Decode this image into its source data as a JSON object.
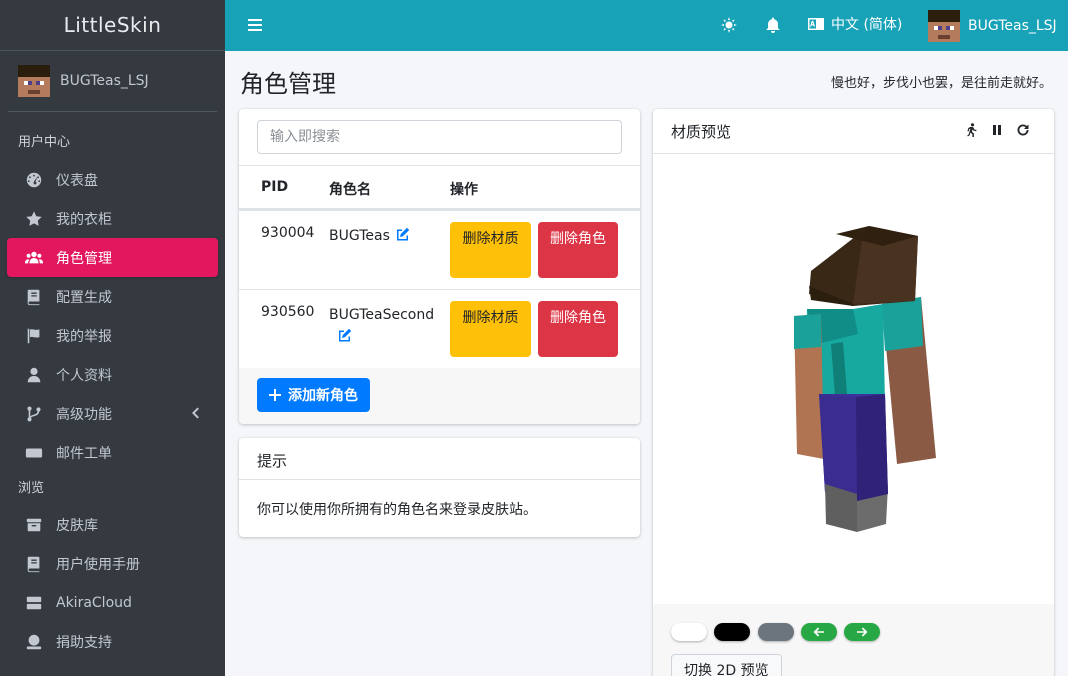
{
  "brand": {
    "name": "LittleSkin"
  },
  "user": {
    "name": "BUGTeas_LSJ"
  },
  "sidebar": {
    "section_user": "用户中心",
    "section_browse": "浏览",
    "items": [
      {
        "label": "仪表盘",
        "icon": "dashboard-icon"
      },
      {
        "label": "我的衣柜",
        "icon": "star-icon"
      },
      {
        "label": "角色管理",
        "icon": "users-icon",
        "active": true
      },
      {
        "label": "配置生成",
        "icon": "book-icon"
      },
      {
        "label": "我的举报",
        "icon": "flag-icon"
      },
      {
        "label": "个人资料",
        "icon": "user-icon"
      },
      {
        "label": "高级功能",
        "icon": "branch-icon"
      },
      {
        "label": "邮件工单",
        "icon": "keyboard-icon"
      },
      {
        "label": "皮肤库",
        "icon": "archive-icon"
      },
      {
        "label": "用户使用手册",
        "icon": "book-icon"
      },
      {
        "label": "AkiraCloud",
        "icon": "server-icon"
      },
      {
        "label": "捐助支持",
        "icon": "donate-icon"
      }
    ]
  },
  "topbar": {
    "language": "中文 (简体)",
    "icons": [
      "menu-icon",
      "sun-icon",
      "bell-icon",
      "language-icon"
    ]
  },
  "page": {
    "title": "角色管理",
    "motto": "慢也好，步伐小也罢，是往前走就好。"
  },
  "players": {
    "search_placeholder": "输入即搜索",
    "columns": [
      "PID",
      "角色名",
      "操作"
    ],
    "rows": [
      {
        "pid": "930004",
        "name": "BUGTeas",
        "delete_texture": "删除材质",
        "delete_player": "删除角色"
      },
      {
        "pid": "930560",
        "name": "BUGTeaSecond",
        "delete_texture": "删除材质",
        "delete_player": "删除角色"
      }
    ],
    "add_button": "添加新角色"
  },
  "tips": {
    "title": "提示",
    "body": "你可以使用你所拥有的角色名来登录皮肤站。"
  },
  "preview": {
    "title": "材质预览",
    "switch_button": "切换 2D 预览",
    "backgrounds": [
      {
        "name": "white",
        "color": "#ffffff"
      },
      {
        "name": "black",
        "color": "#000000"
      },
      {
        "name": "gray",
        "color": "#6c757d"
      },
      {
        "name": "prev",
        "color": "#28a745"
      },
      {
        "name": "next",
        "color": "#28a745"
      }
    ]
  },
  "colors": {
    "sidebar_bg": "#343a40",
    "topbar_bg": "#17a2b8",
    "active_item": "#e2175e",
    "warning": "#ffc107",
    "danger": "#dc3545",
    "primary": "#007bff",
    "success": "#28a745"
  }
}
